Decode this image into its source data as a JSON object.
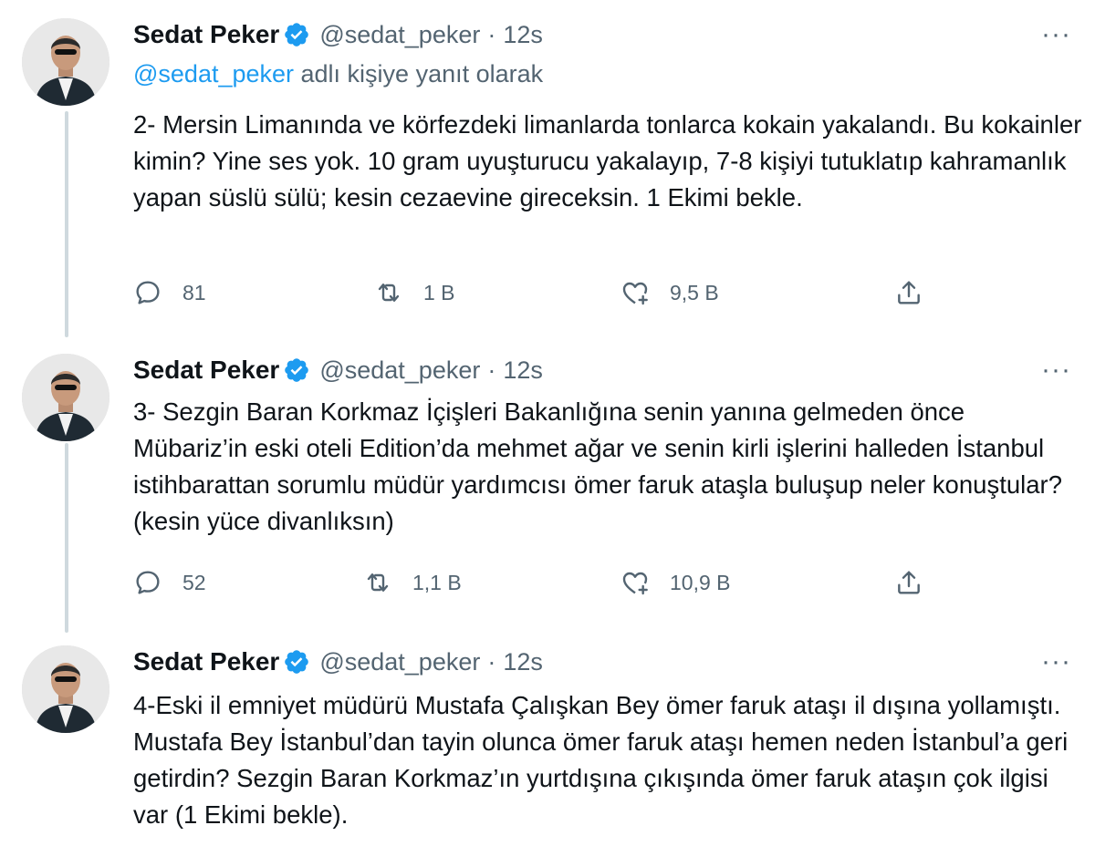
{
  "tweets": [
    {
      "name": "Sedat Peker",
      "handle": "@sedat_peker",
      "separator": "·",
      "time": "12s",
      "more": "···",
      "reply_mention": "@sedat_peker",
      "reply_suffix": " adlı kişiye yanıt olarak",
      "text": "2- Mersin Limanında ve  körfezdeki limanlarda tonlarca kokain yakalandı. Bu kokainler kimin? Yine ses yok. 10 gram uyuşturucu yakalayıp, 7-8 kişiyi tutuklatıp kahramanlık yapan süslü sülü; kesin cezaevine gireceksin. 1 Ekimi bekle.",
      "replies": "81",
      "retweets": "1 B",
      "likes": "9,5 B"
    },
    {
      "name": "Sedat Peker",
      "handle": "@sedat_peker",
      "separator": "·",
      "time": "12s",
      "more": "···",
      "text": "3- Sezgin Baran Korkmaz İçişleri Bakanlığına senin yanına gelmeden önce Mübariz’in eski oteli Edition’da mehmet ağar ve senin kirli işlerini halleden İstanbul istihbarattan sorumlu müdür yardımcısı ömer faruk ataşla buluşup neler konuştular? (kesin yüce divanlıksın)",
      "replies": "52",
      "retweets": "1,1 B",
      "likes": "10,9 B"
    },
    {
      "name": "Sedat Peker",
      "handle": "@sedat_peker",
      "separator": "·",
      "time": "12s",
      "more": "···",
      "text": "4-Eski il emniyet müdürü Mustafa Çalışkan Bey ömer faruk ataşı il dışına yollamıştı. Mustafa Bey İstanbul’dan tayin olunca ömer faruk ataşı hemen neden İstanbul’a geri getirdin? Sezgin Baran Korkmaz’ın yurtdışına çıkışında ömer faruk ataşın çok ilgisi var (1 Ekimi bekle)."
    }
  ],
  "icons": {
    "reply": "reply-icon",
    "retweet": "retweet-icon",
    "like": "like-icon",
    "share": "share-icon",
    "verified": "verified-badge-icon"
  },
  "colors": {
    "verified": "#1d9bf0",
    "mention": "#1d9bf0",
    "secondary": "#536471",
    "thread_line": "#cfd9de"
  }
}
